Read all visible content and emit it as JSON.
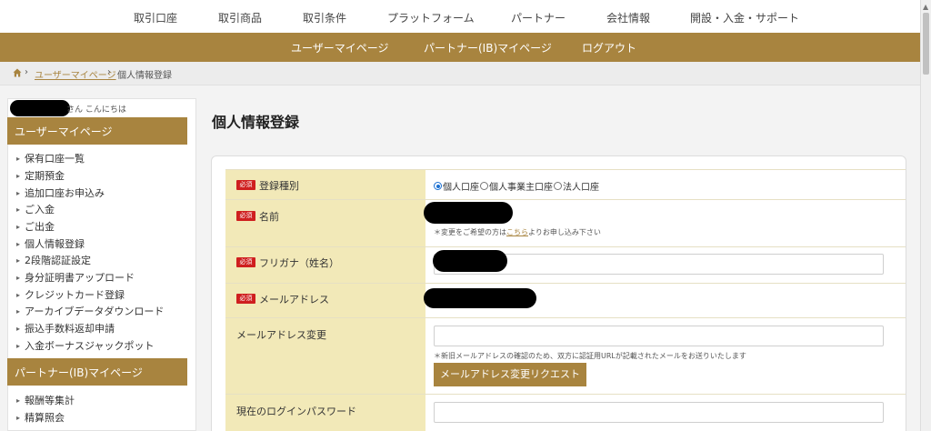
{
  "top_nav": [
    "取引口座",
    "取引商品",
    "取引条件",
    "プラットフォーム",
    "パートナー",
    "会社情報",
    "開設・入金・サポート"
  ],
  "gold_nav": [
    "ユーザーマイページ",
    "パートナー(IB)マイページ",
    "ログアウト"
  ],
  "breadcrumb": {
    "home_icon": "home-icon",
    "sep": "›",
    "link": "ユーザーマイページ",
    "current": "個人情報登録"
  },
  "sidebar": {
    "greeting_suffix": "さん こんにちは",
    "user_section": "ユーザーマイページ",
    "user_items": [
      "保有口座一覧",
      "定期預金",
      "追加口座お申込み",
      "ご入金",
      "ご出金",
      "個人情報登録",
      "2段階認証設定",
      "身分証明書アップロード",
      "クレジットカード登録",
      "アーカイブデータダウンロード",
      "振込手数料返却申請",
      "入金ボーナスジャックポット"
    ],
    "partner_section": "パートナー(IB)マイページ",
    "partner_items": [
      "報酬等集計",
      "精算照会"
    ]
  },
  "main": {
    "title": "個人情報登録",
    "required_badge": "必須",
    "fields": {
      "account_type": {
        "label": "登録種別",
        "options": [
          "個人口座",
          "個人事業主口座",
          "法人口座"
        ],
        "selected": "個人口座"
      },
      "name": {
        "label": "名前",
        "note_pre": "＊変更をご希望の方は",
        "note_link": "こちら",
        "note_post": "よりお申し込み下さい"
      },
      "furigana": {
        "label": "フリガナ（姓名）"
      },
      "email": {
        "label": "メールアドレス"
      },
      "email_change": {
        "label": "メールアドレス変更",
        "value": "",
        "note": "＊新旧メールアドレスの確認のため、双方に認証用URLが記載されたメールをお送りいたします",
        "button": "メールアドレス変更リクエスト"
      },
      "current_password": {
        "label": "現在のログインパスワード",
        "value": ""
      }
    }
  },
  "colors": {
    "accent": "#a8843f",
    "label_bg": "#f2e9b8",
    "required": "#cf1f1f"
  }
}
